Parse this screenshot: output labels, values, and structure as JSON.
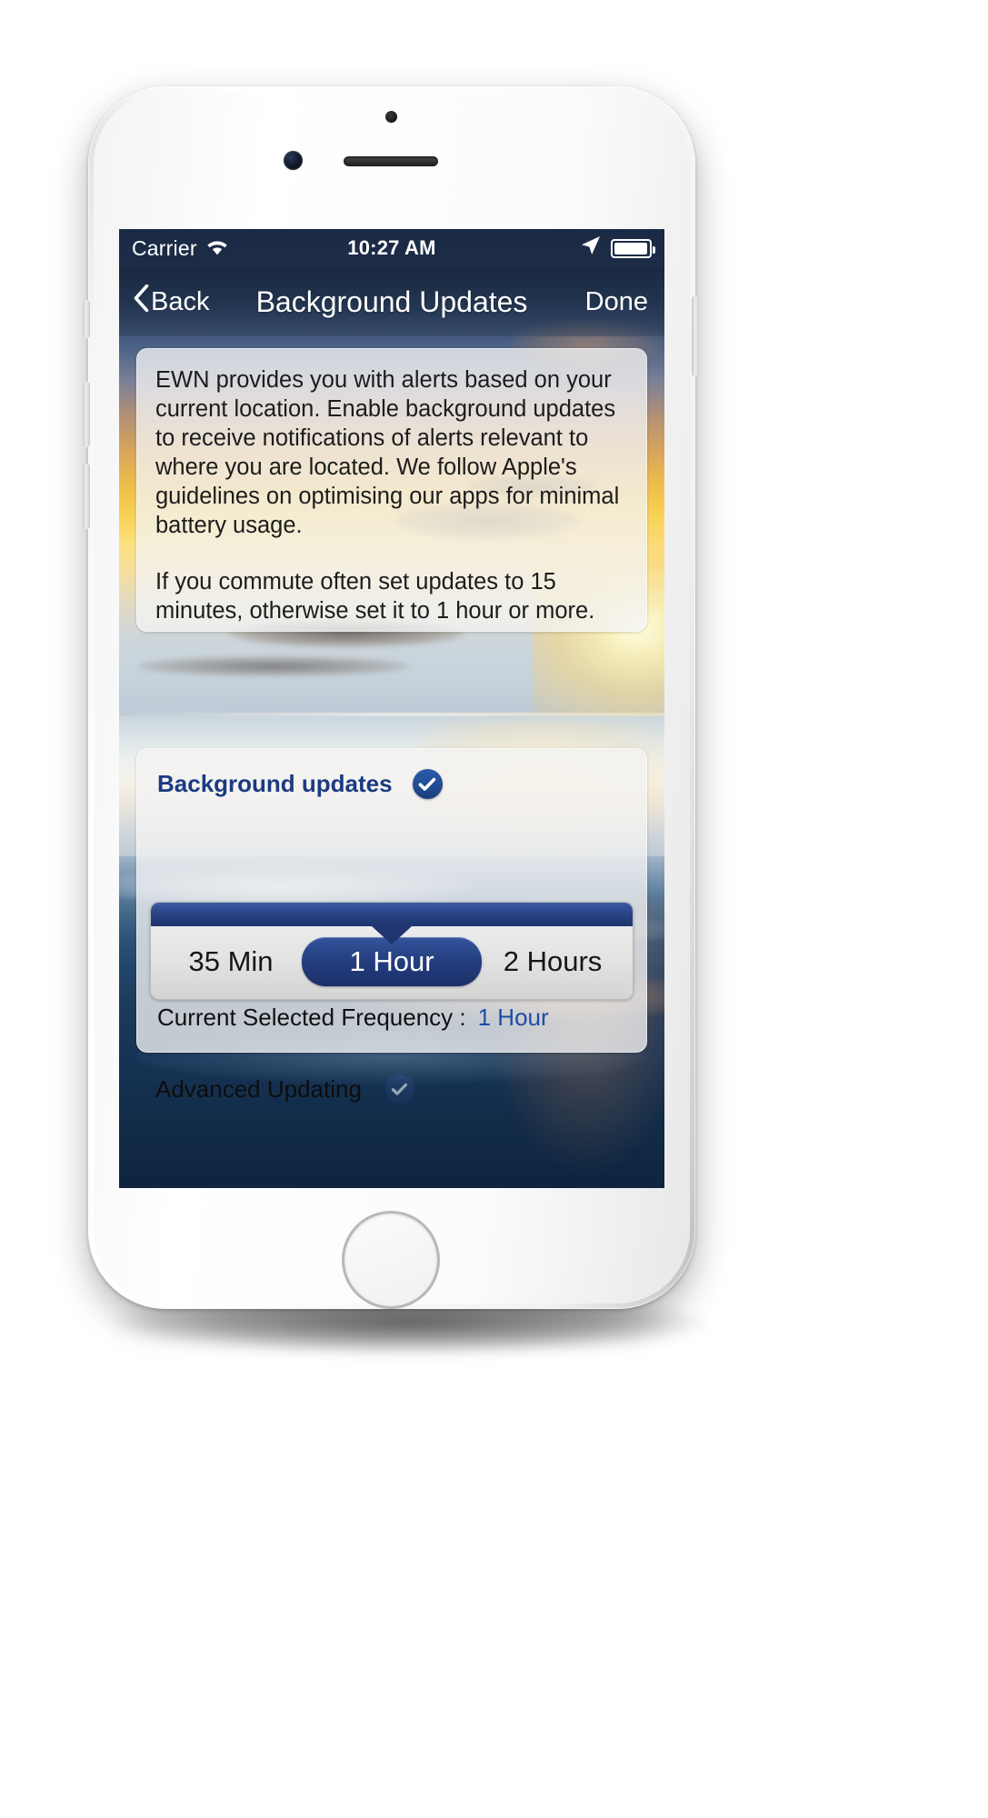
{
  "device": {
    "name": "iphone-white",
    "hardware": {
      "earpiece": "earpiece-speaker",
      "front_camera": "front-camera",
      "sensor": "proximity-sensor",
      "home_button": "home-button"
    }
  },
  "status_bar": {
    "carrier": "Carrier",
    "wifi_icon": "wifi-icon",
    "time": "10:27 AM",
    "location_icon": "location-arrow-icon",
    "battery_icon": "battery-icon",
    "battery_level_pct": 88
  },
  "nav_bar": {
    "back_label": "Back",
    "back_icon": "chevron-left-icon",
    "title": "Background Updates",
    "done_label": "Done"
  },
  "info_card": {
    "paragraphs": [
      "EWN provides you with alerts based on your current location. Enable background updates to receive notifications of alerts relevant to where you are located. We follow Apple's guidelines on optimising our apps for minimal battery usage.",
      "If you commute often set updates to 15 minutes, otherwise set it to 1 hour or more."
    ]
  },
  "settings_card": {
    "background_updates": {
      "label": "Background updates",
      "checked": true,
      "check_icon": "check-circle-icon"
    },
    "frequency_segmented_control": {
      "options": [
        "35 Min",
        "1 Hour",
        "2 Hours"
      ],
      "selected_index": 1,
      "selected_value": "1 Hour"
    },
    "current_frequency": {
      "label": "Current Selected Frequency :",
      "value": "1 Hour"
    }
  },
  "advanced_updating": {
    "label": "Advanced Updating",
    "checked": true,
    "check_icon": "check-circle-icon"
  },
  "colors": {
    "status_bar_bg": "#1b2a44",
    "brand_blue": "#1b3f82",
    "segment_selected_bg": "#223c7d",
    "link_blue": "#1d4ea8",
    "card_bg": "#f4f4f4"
  }
}
